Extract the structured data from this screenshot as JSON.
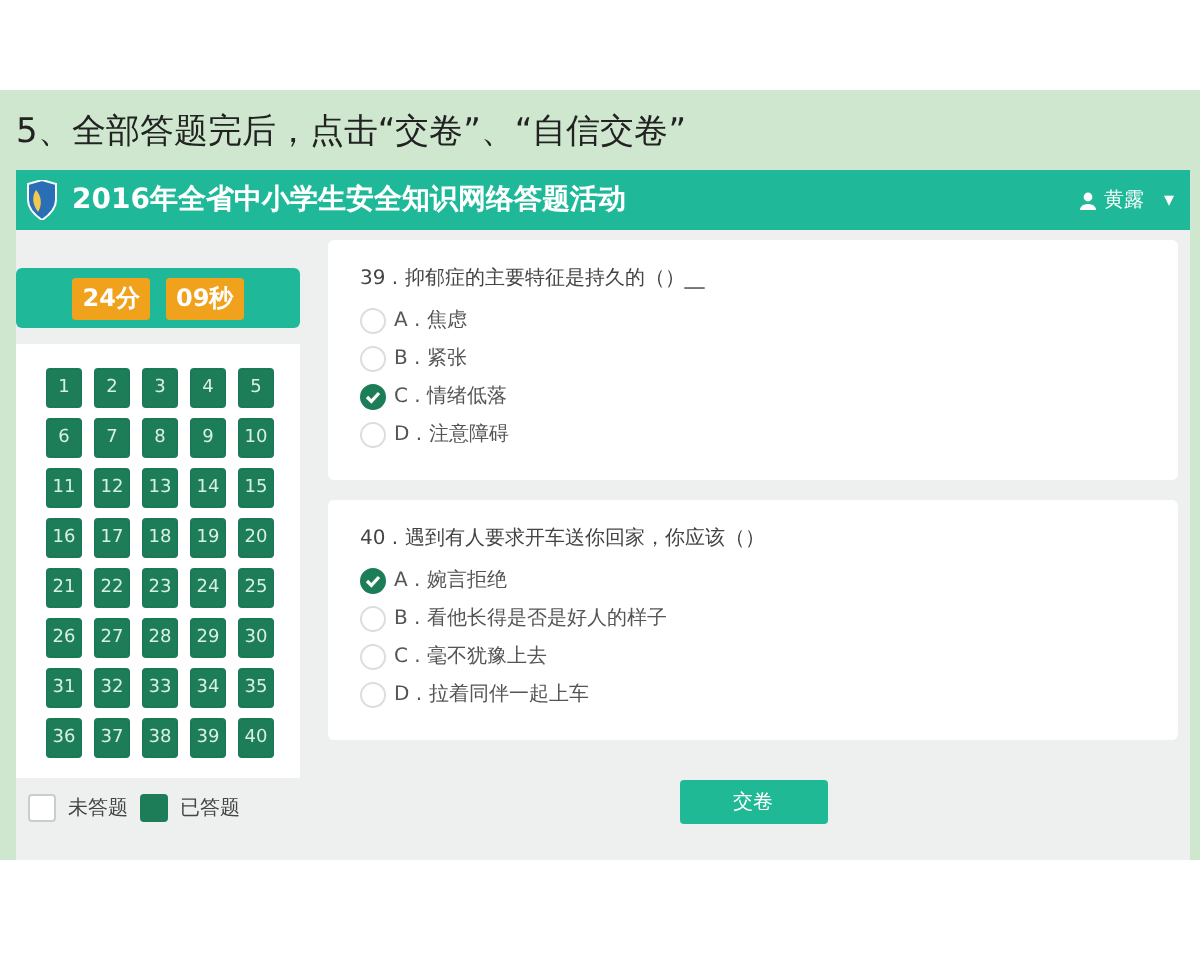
{
  "instruction": "5、全部答题完后，点击“交卷”、“自信交卷”",
  "app": {
    "title": "2016年全省中小学生安全知识网络答题活动",
    "user": "黄露",
    "user_menu_caret": "▾"
  },
  "timer": {
    "minutes": "24分",
    "seconds": "09秒"
  },
  "answer_grid": [
    {
      "label": "1",
      "answered": true
    },
    {
      "label": "2",
      "answered": true
    },
    {
      "label": "3",
      "answered": true
    },
    {
      "label": "4",
      "answered": true
    },
    {
      "label": "5",
      "answered": true
    },
    {
      "label": "6",
      "answered": true
    },
    {
      "label": "7",
      "answered": true
    },
    {
      "label": "8",
      "answered": true
    },
    {
      "label": "9",
      "answered": true
    },
    {
      "label": "10",
      "answered": true
    },
    {
      "label": "11",
      "answered": true
    },
    {
      "label": "12",
      "answered": true
    },
    {
      "label": "13",
      "answered": true
    },
    {
      "label": "14",
      "answered": true
    },
    {
      "label": "15",
      "answered": true
    },
    {
      "label": "16",
      "answered": true
    },
    {
      "label": "17",
      "answered": true
    },
    {
      "label": "18",
      "answered": true
    },
    {
      "label": "19",
      "answered": true
    },
    {
      "label": "20",
      "answered": true
    },
    {
      "label": "21",
      "answered": true
    },
    {
      "label": "22",
      "answered": true
    },
    {
      "label": "23",
      "answered": true
    },
    {
      "label": "24",
      "answered": true
    },
    {
      "label": "25",
      "answered": true
    },
    {
      "label": "26",
      "answered": true
    },
    {
      "label": "27",
      "answered": true
    },
    {
      "label": "28",
      "answered": true
    },
    {
      "label": "29",
      "answered": true
    },
    {
      "label": "30",
      "answered": true
    },
    {
      "label": "31",
      "answered": true
    },
    {
      "label": "32",
      "answered": true
    },
    {
      "label": "33",
      "answered": true
    },
    {
      "label": "34",
      "answered": true
    },
    {
      "label": "35",
      "answered": true
    },
    {
      "label": "36",
      "answered": true
    },
    {
      "label": "37",
      "answered": true
    },
    {
      "label": "38",
      "answered": true
    },
    {
      "label": "39",
      "answered": true
    },
    {
      "label": "40",
      "answered": true
    }
  ],
  "legend": [
    {
      "label": "未答题",
      "answered": false
    },
    {
      "label": "已答题",
      "answered": true
    }
  ],
  "questions": [
    {
      "number": "39 .",
      "text": "抑郁症的主要特征是持久的（）__",
      "options": [
        {
          "letter": "A .",
          "text": "焦虑",
          "selected": false
        },
        {
          "letter": "B .",
          "text": "紧张",
          "selected": false
        },
        {
          "letter": "C .",
          "text": "情绪低落",
          "selected": true
        },
        {
          "letter": "D .",
          "text": "注意障碍",
          "selected": false
        }
      ]
    },
    {
      "number": "40 .",
      "text": "遇到有人要求开车送你回家，你应该（）",
      "options": [
        {
          "letter": "A .",
          "text": "婉言拒绝",
          "selected": true
        },
        {
          "letter": "B .",
          "text": "看他长得是否是好人的样子",
          "selected": false
        },
        {
          "letter": "C .",
          "text": "毫不犹豫上去",
          "selected": false
        },
        {
          "letter": "D .",
          "text": "拉着同伴一起上车",
          "selected": false
        }
      ]
    }
  ],
  "submit_button": "交卷"
}
